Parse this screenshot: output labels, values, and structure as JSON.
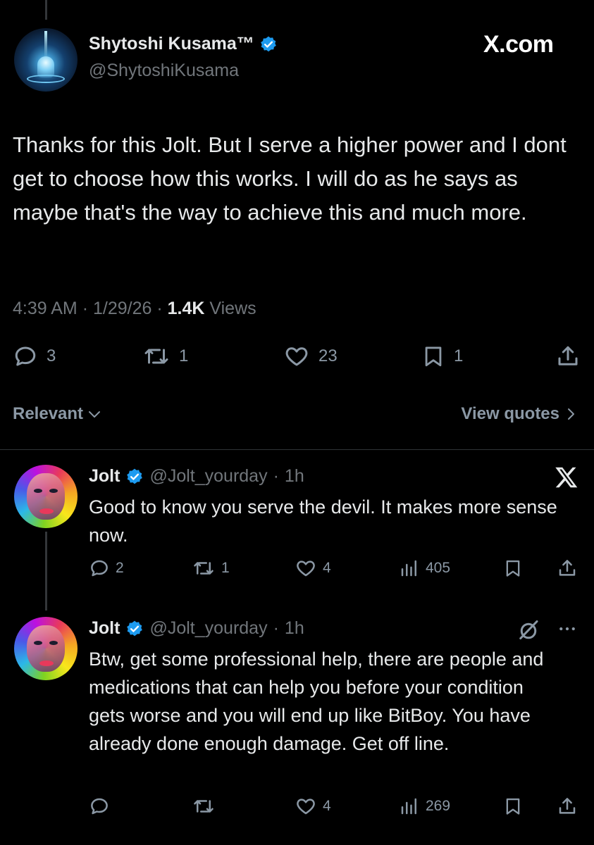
{
  "main_post": {
    "author_name": "Shytoshi Kusama™",
    "author_handle": "@ShytoshiKusama",
    "site_label": "X.com",
    "text": "Thanks for this Jolt. But I serve a higher power and I dont get to choose how this works. I will do as he says as maybe that's the way to achieve this and much more.",
    "time": "4:39 AM",
    "date": "1/29/26",
    "views_count": "1.4K",
    "views_label": "Views",
    "replies": "3",
    "reposts": "1",
    "likes": "23",
    "bookmarks": "1"
  },
  "sort": {
    "label": "Relevant",
    "view_quotes": "View quotes"
  },
  "replies": [
    {
      "author_name": "Jolt",
      "author_handle": "@Jolt_yourday",
      "age": "1h",
      "text": "Good to know you serve the devil. It makes more sense now.",
      "replies": "2",
      "reposts": "1",
      "likes": "4",
      "views": "405"
    },
    {
      "author_name": "Jolt",
      "author_handle": "@Jolt_yourday",
      "age": "1h",
      "text": "Btw, get some professional help, there are people and medications that can help you before your condition gets worse and you will end up like BitBoy. You have already done enough damage. Get off line.",
      "replies": "",
      "reposts": "",
      "likes": "4",
      "views": "269"
    }
  ],
  "colors": {
    "background": "#000000",
    "text": "#e7e9ea",
    "secondary": "#71767b",
    "verified": "#1d9bf0"
  }
}
